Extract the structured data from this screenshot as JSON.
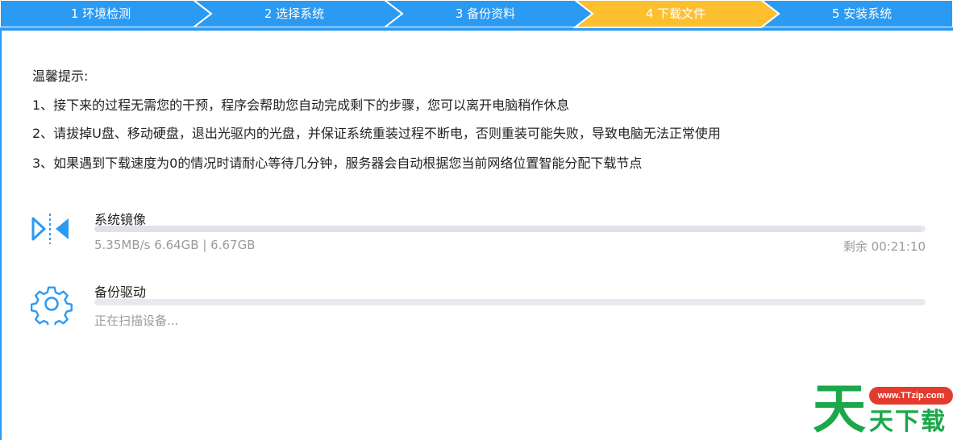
{
  "steps": [
    {
      "label": "1 环境检测",
      "state": "done"
    },
    {
      "label": "2 选择系统",
      "state": "done"
    },
    {
      "label": "3 备份资料",
      "state": "done"
    },
    {
      "label": "4 下载文件",
      "state": "active"
    },
    {
      "label": "5 安装系统",
      "state": "pending"
    }
  ],
  "colors": {
    "step": "#2b9af3",
    "active_step": "#fdbf2d",
    "accent": "#2b9af3"
  },
  "tips": {
    "title": "温馨提示:",
    "lines": [
      "1、接下来的过程无需您的干预，程序会帮助您自动完成剩下的步骤，您可以离开电脑稍作休息",
      "2、请拔掉U盘、移动硬盘，退出光驱内的光盘，并保证系统重装过程不断电，否则重装可能失败，导致电脑无法正常使用",
      "3、如果遇到下载速度为0的情况时请耐心等待几分钟，服务器会自动根据您当前网络位置智能分配下载节点"
    ]
  },
  "tasks": [
    {
      "name": "系统镜像",
      "icon": "download-arrows-icon",
      "status": "5.35MB/s 6.64GB | 6.67GB",
      "remaining": "剩余 00:21:10",
      "progress": 0.995
    },
    {
      "name": "备份驱动",
      "icon": "gear-icon",
      "status": "正在扫描设备...",
      "remaining": "",
      "progress": 0
    }
  ],
  "watermark": {
    "url": "www.TTzip.com",
    "glyph": "天",
    "name": "天下载"
  }
}
